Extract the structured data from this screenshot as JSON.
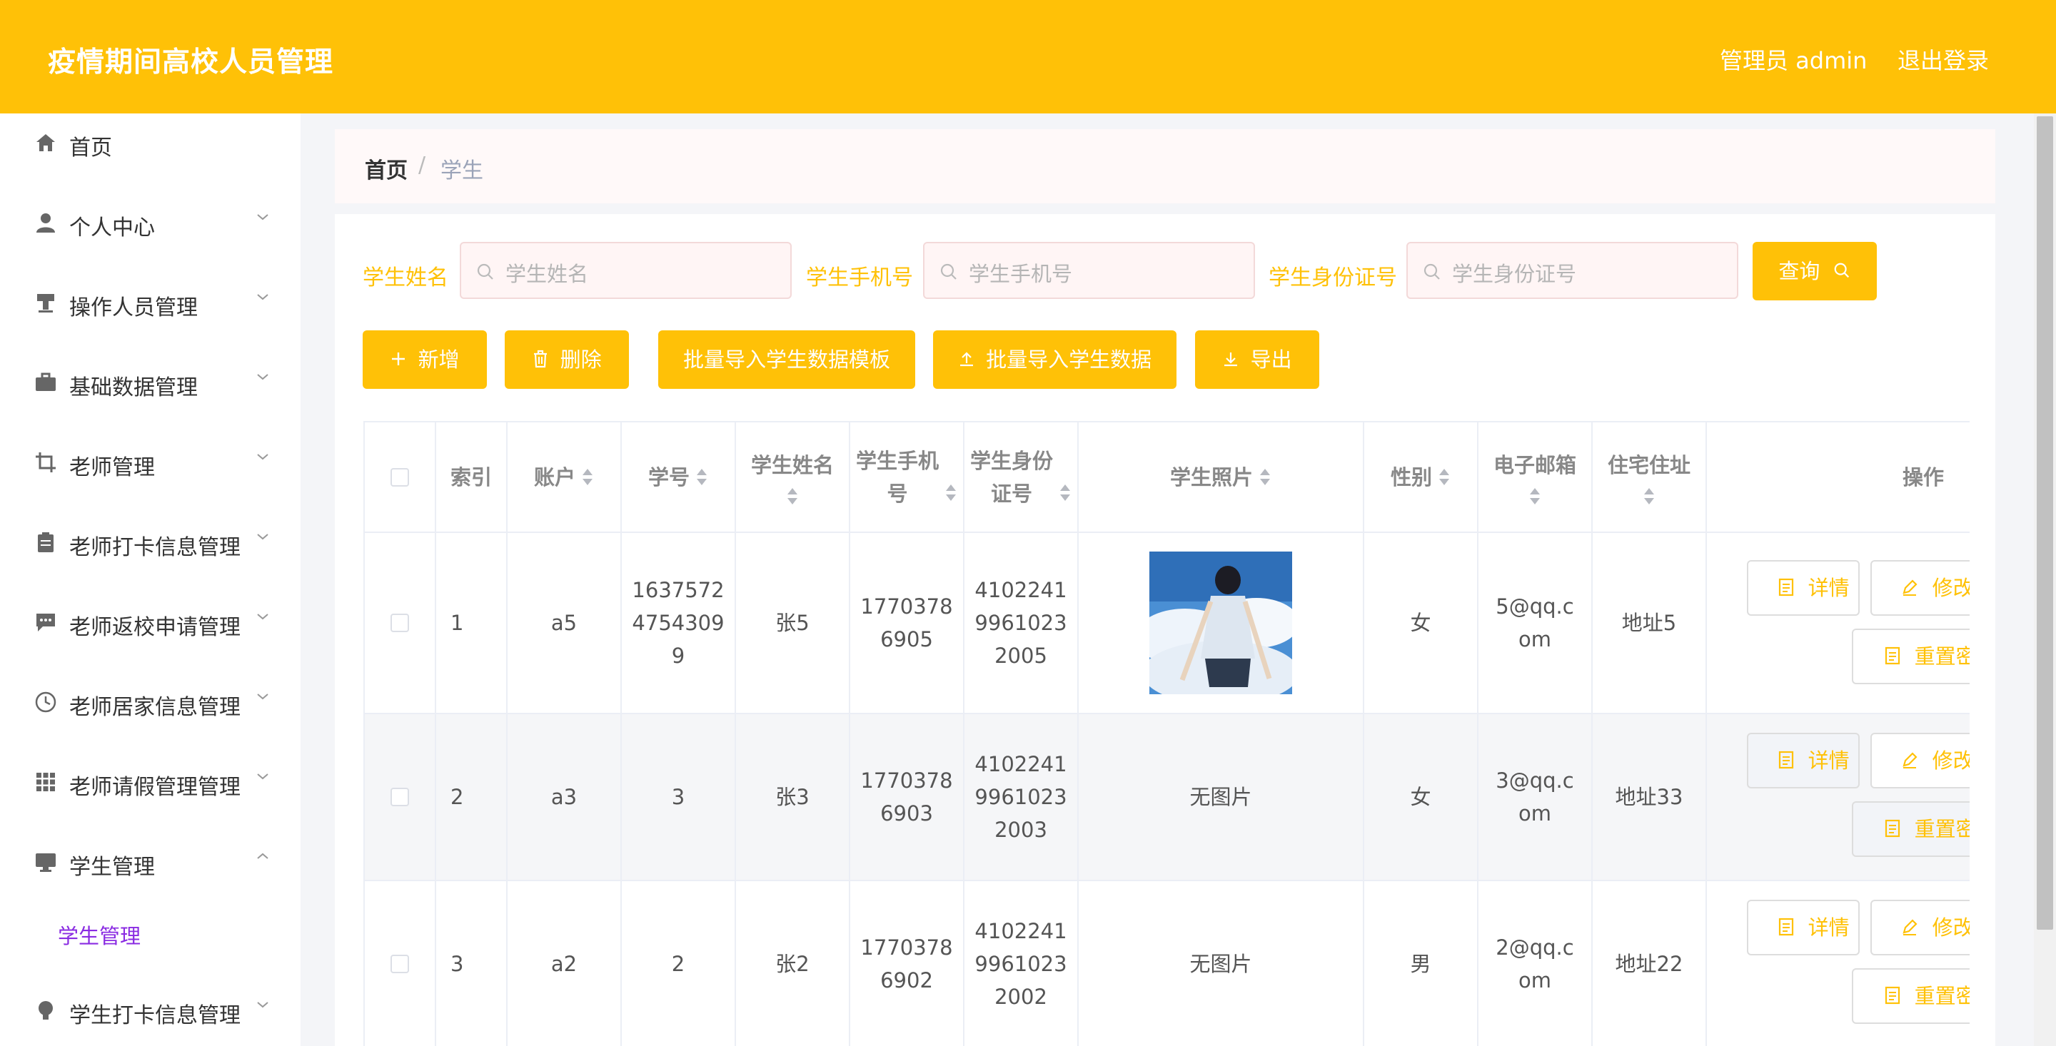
{
  "header": {
    "title": "疫情期间高校人员管理",
    "admin_label": "管理员 admin",
    "logout_label": "退出登录"
  },
  "sidebar": {
    "items": [
      {
        "label": "首页",
        "icon": "home-icon"
      },
      {
        "label": "个人中心",
        "icon": "user-icon"
      },
      {
        "label": "操作人员管理",
        "icon": "stamp-icon"
      },
      {
        "label": "基础数据管理",
        "icon": "briefcase-icon"
      },
      {
        "label": "老师管理",
        "icon": "crop-icon"
      },
      {
        "label": "老师打卡信息管理",
        "icon": "clipboard-icon"
      },
      {
        "label": "老师返校申请管理",
        "icon": "chat-icon"
      },
      {
        "label": "老师居家信息管理",
        "icon": "clock-icon"
      },
      {
        "label": "老师请假管理管理",
        "icon": "grid-icon"
      },
      {
        "label": "学生管理",
        "icon": "monitor-icon"
      },
      {
        "label": "学生打卡信息管理",
        "icon": "bulb-icon"
      }
    ],
    "submenu": {
      "label": "学生管理"
    }
  },
  "breadcrumb": {
    "home": "首页",
    "separator": "/",
    "current": "学生"
  },
  "search": {
    "name_label": "学生姓名",
    "name_placeholder": "学生姓名",
    "phone_label": "学生手机号",
    "phone_placeholder": "学生手机号",
    "idcard_label": "学生身份证号",
    "idcard_placeholder": "学生身份证号",
    "query_label": "查询"
  },
  "toolbar": {
    "add_label": "新增",
    "delete_label": "删除",
    "template_label": "批量导入学生数据模板",
    "import_label": "批量导入学生数据",
    "export_label": "导出"
  },
  "table": {
    "headers": {
      "index": "索引",
      "account": "账户",
      "student_no": "学号",
      "name": "学生姓名",
      "phone": "学生手机\n号",
      "idcard": "学生身份\n证号",
      "photo": "学生照片",
      "gender": "性别",
      "email": "电子邮箱",
      "address": "住宅住址",
      "actions": "操作"
    },
    "rows": [
      {
        "index": "1",
        "account": "a5",
        "student_no": "1637572\n4754309\n9",
        "name": "张5",
        "phone": "1770378\n6905",
        "idcard": "4102241\n9961023\n2005",
        "photo": "",
        "gender": "女",
        "email": "5@qq.c\nom",
        "address": "地址5"
      },
      {
        "index": "2",
        "account": "a3",
        "student_no": "3",
        "name": "张3",
        "phone": "1770378\n6903",
        "idcard": "4102241\n9961023\n2003",
        "photo": "无图片",
        "gender": "女",
        "email": "3@qq.c\nom",
        "address": "地址33"
      },
      {
        "index": "3",
        "account": "a2",
        "student_no": "2",
        "name": "张2",
        "phone": "1770378\n6902",
        "idcard": "4102241\n9961023\n2002",
        "photo": "无图片",
        "gender": "男",
        "email": "2@qq.c\nom",
        "address": "地址22"
      }
    ],
    "actions": {
      "detail": "详情",
      "edit": "修改",
      "reset": "重置密码"
    }
  },
  "colors": {
    "accent": "#ffc107",
    "submenu_active": "#8a2be2"
  }
}
